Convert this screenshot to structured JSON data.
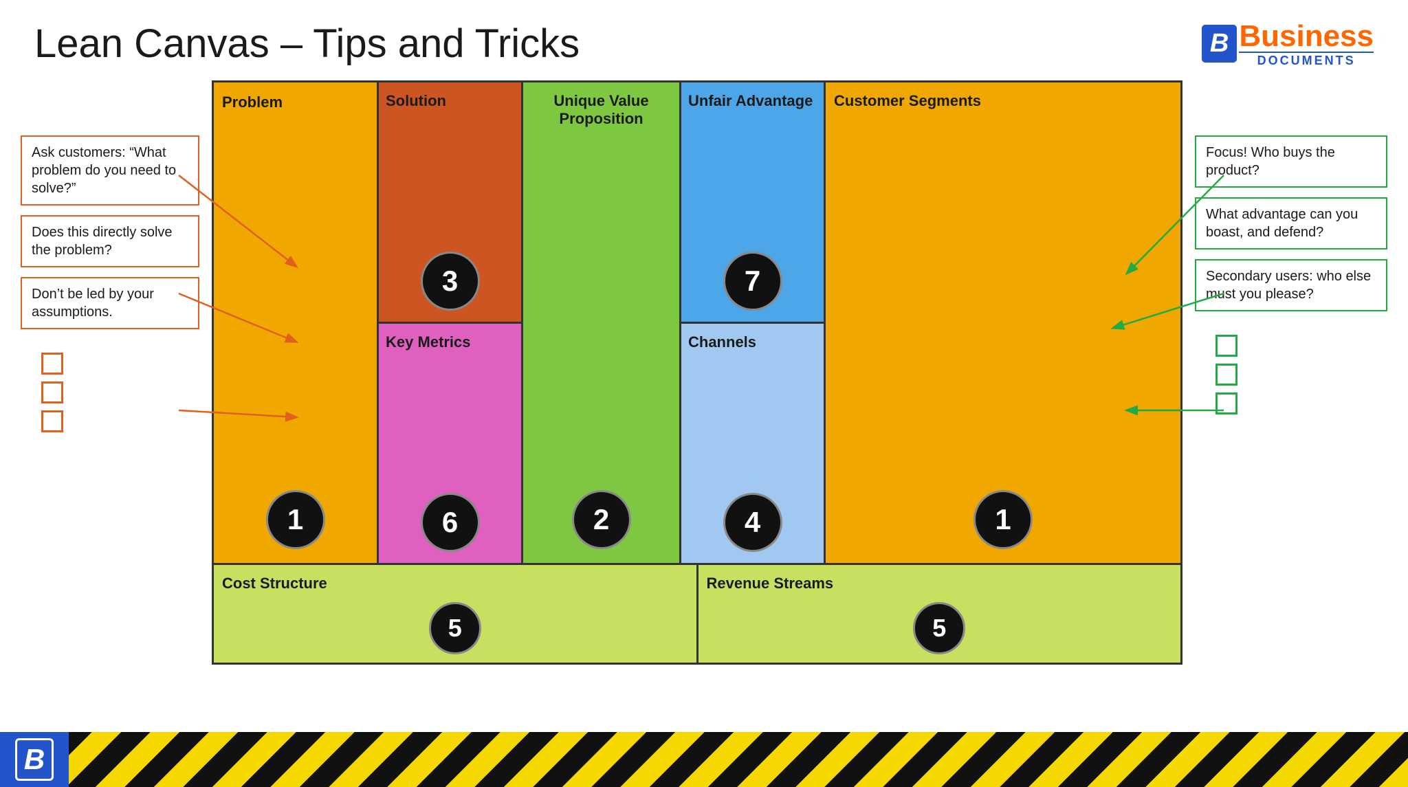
{
  "header": {
    "title": "Lean Canvas – Tips and Tricks",
    "logo": {
      "icon": "B",
      "business": "Business",
      "documents": "DOCUMENTS"
    }
  },
  "canvas": {
    "cells": {
      "problem": {
        "label": "Problem",
        "number": "1"
      },
      "solution": {
        "label": "Solution",
        "number": "3"
      },
      "uvp": {
        "label": "Unique Value Proposition",
        "number": "2"
      },
      "unfair": {
        "label": "Unfair Advantage",
        "number": "7"
      },
      "customer_segments": {
        "label": "Customer Segments",
        "number": "1"
      },
      "key_metrics": {
        "label": "Key Metrics",
        "number": "6"
      },
      "channels": {
        "label": "Channels",
        "number": "4"
      },
      "cost_structure": {
        "label": "Cost Structure",
        "number": "5"
      },
      "revenue_streams": {
        "label": "Revenue Streams",
        "number": "5"
      }
    }
  },
  "left_annotations": [
    {
      "text": "Ask customers: “What problem do you need to solve?”",
      "color": "orange"
    },
    {
      "text": "Does this directly solve the problem?",
      "color": "orange"
    },
    {
      "text": "Don’t be led by your assumptions.",
      "color": "orange"
    }
  ],
  "right_annotations": [
    {
      "text": "Focus! Who buys the product?",
      "color": "green"
    },
    {
      "text": "What advantage can you boast, and defend?",
      "color": "green"
    },
    {
      "text": "Secondary users: who else must you please?",
      "color": "green"
    }
  ],
  "left_checkboxes": 3,
  "right_checkboxes": 3,
  "footer": {
    "logo_letter": "B"
  }
}
